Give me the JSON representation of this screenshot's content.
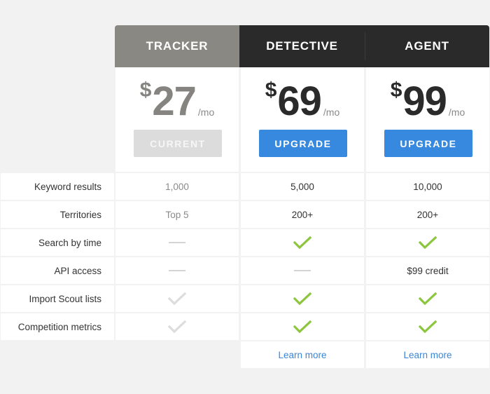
{
  "plans": [
    {
      "name": "TRACKER",
      "currency": "$",
      "price": "27",
      "period": "/mo",
      "button": "CURRENT",
      "button_state": "current",
      "header_color": "#898883"
    },
    {
      "name": "DETECTIVE",
      "currency": "$",
      "price": "69",
      "period": "/mo",
      "button": "UPGRADE",
      "button_state": "upgrade",
      "header_color": "#2a2a2a",
      "learn_more": "Learn more"
    },
    {
      "name": "AGENT",
      "currency": "$",
      "price": "99",
      "period": "/mo",
      "button": "UPGRADE",
      "button_state": "upgrade",
      "header_color": "#2a2a2a",
      "learn_more": "Learn more"
    }
  ],
  "features": [
    {
      "label": "Keyword results",
      "values": [
        {
          "type": "text",
          "text": "1,000",
          "muted": true
        },
        {
          "type": "text",
          "text": "5,000"
        },
        {
          "type": "text",
          "text": "10,000"
        }
      ]
    },
    {
      "label": "Territories",
      "values": [
        {
          "type": "text",
          "text": "Top 5",
          "muted": true
        },
        {
          "type": "text",
          "text": "200+"
        },
        {
          "type": "text",
          "text": "200+"
        }
      ]
    },
    {
      "label": "Search by time",
      "values": [
        {
          "type": "dash"
        },
        {
          "type": "check",
          "active": true
        },
        {
          "type": "check",
          "active": true
        }
      ]
    },
    {
      "label": "API access",
      "values": [
        {
          "type": "dash"
        },
        {
          "type": "dash"
        },
        {
          "type": "text",
          "text": "$99 credit"
        }
      ]
    },
    {
      "label": "Import Scout lists",
      "values": [
        {
          "type": "check",
          "active": false
        },
        {
          "type": "check",
          "active": true
        },
        {
          "type": "check",
          "active": true
        }
      ]
    },
    {
      "label": "Competition metrics",
      "values": [
        {
          "type": "check",
          "active": false
        },
        {
          "type": "check",
          "active": true
        },
        {
          "type": "check",
          "active": true
        }
      ]
    }
  ],
  "colors": {
    "accent": "#3689de",
    "check_active": "#8cc63f",
    "check_inactive": "#dddddd",
    "link": "#3b86d6"
  }
}
